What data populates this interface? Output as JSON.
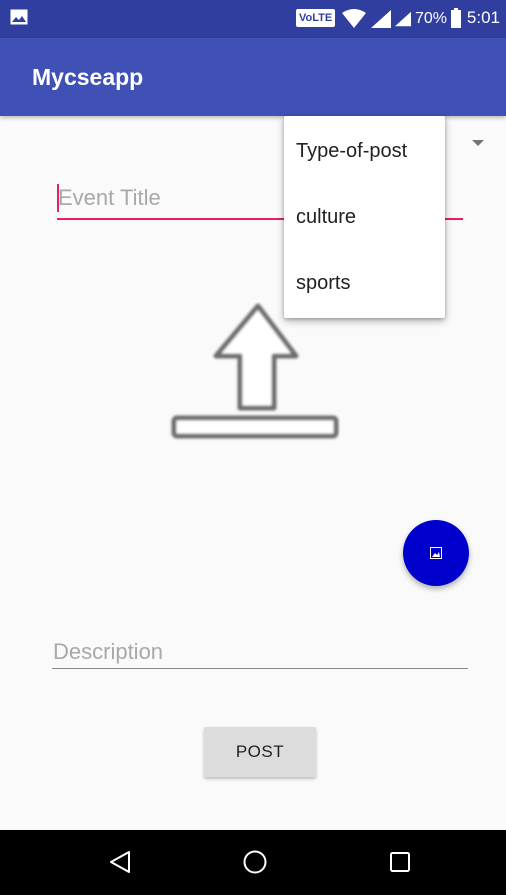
{
  "status_bar": {
    "volte": "VoLTE",
    "battery_percent": "70%",
    "time": "5:01",
    "icons": [
      "gallery-icon",
      "wifi-icon",
      "signal-icon",
      "signal-icon",
      "battery-icon"
    ]
  },
  "app_bar": {
    "title": "Mycseapp",
    "color": "#3f51b5"
  },
  "form": {
    "title_placeholder": "Event Title",
    "description_placeholder": "Description",
    "post_label": "POST",
    "accent_color": "#e91e63"
  },
  "dropdown": {
    "items": [
      "Type-of-post",
      "culture",
      "sports"
    ]
  },
  "fab": {
    "icon": "image-icon",
    "color": "#0000cc"
  },
  "upload": {
    "icon": "upload-icon"
  },
  "nav_bar": {
    "icons": [
      "back-icon",
      "home-icon",
      "recents-icon"
    ]
  }
}
